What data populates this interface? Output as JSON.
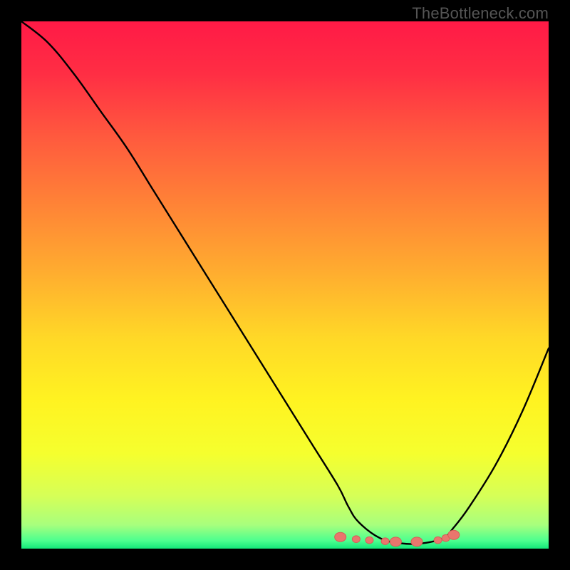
{
  "watermark": "TheBottleneck.com",
  "chart_data": {
    "type": "line",
    "title": "",
    "xlabel": "",
    "ylabel": "",
    "xlim": [
      0,
      100
    ],
    "ylim": [
      0,
      100
    ],
    "series": [
      {
        "name": "bottleneck-curve",
        "x": [
          0,
          5,
          10,
          15,
          20,
          25,
          30,
          35,
          40,
          45,
          50,
          55,
          60,
          62,
          64,
          68,
          72,
          76,
          80,
          82,
          85,
          90,
          95,
          100
        ],
        "values": [
          100,
          96,
          90,
          83,
          76,
          68,
          60,
          52,
          44,
          36,
          28,
          20,
          12,
          8,
          5,
          2,
          1,
          1,
          2,
          4,
          8,
          16,
          26,
          38
        ]
      },
      {
        "name": "optimal-markers",
        "x": [
          60.5,
          63.5,
          66,
          69,
          71,
          75,
          79,
          80.5,
          82
        ],
        "values": [
          2.2,
          1.8,
          1.6,
          1.4,
          1.3,
          1.3,
          1.6,
          2.0,
          2.6
        ]
      }
    ],
    "gradient_stops": [
      {
        "offset": 0.0,
        "color": "#ff1a46"
      },
      {
        "offset": 0.1,
        "color": "#ff2e44"
      },
      {
        "offset": 0.22,
        "color": "#ff5a3e"
      },
      {
        "offset": 0.35,
        "color": "#ff8436"
      },
      {
        "offset": 0.48,
        "color": "#ffae2f"
      },
      {
        "offset": 0.6,
        "color": "#ffd827"
      },
      {
        "offset": 0.72,
        "color": "#fff321"
      },
      {
        "offset": 0.82,
        "color": "#f5ff2e"
      },
      {
        "offset": 0.9,
        "color": "#d6ff57"
      },
      {
        "offset": 0.955,
        "color": "#a8ff7d"
      },
      {
        "offset": 0.985,
        "color": "#4cff8f"
      },
      {
        "offset": 1.0,
        "color": "#14e87a"
      }
    ],
    "colors": {
      "curve": "#000000",
      "marker_fill": "#e9766d",
      "marker_stroke": "#d65f56"
    }
  }
}
